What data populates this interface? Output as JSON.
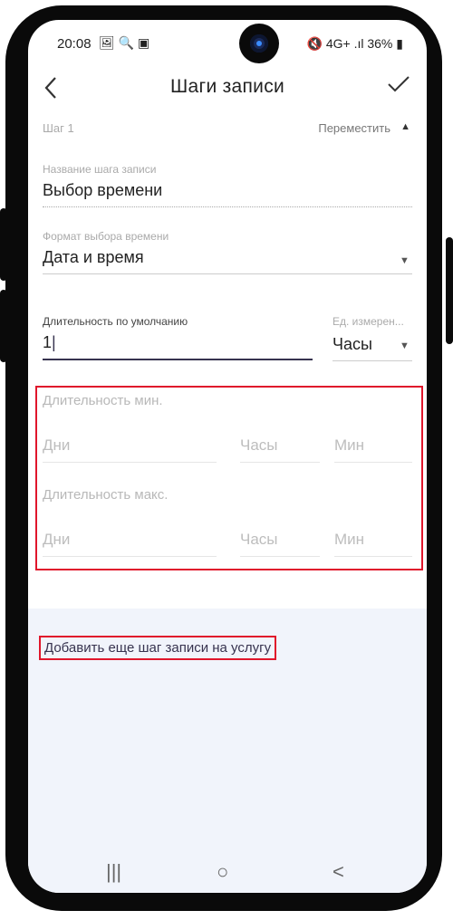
{
  "status_bar": {
    "time": "20:08",
    "left_icons": "🖼 🔍 ▣",
    "right_icons": "🔇 4G+ .ıl",
    "battery": "36%"
  },
  "app_bar": {
    "back_icon": "chevron-left-icon",
    "title": "Шаги записи",
    "confirm_icon": "check-icon"
  },
  "step": {
    "label": "Шаг 1",
    "move_label": "Переместить"
  },
  "step_name": {
    "label": "Название шага записи",
    "value": "Выбор времени"
  },
  "time_format": {
    "label": "Формат выбора времени",
    "value": "Дата и время"
  },
  "default_duration": {
    "label": "Длительность по умолчанию",
    "value": "1",
    "unit_label": "Ед. измерен...",
    "unit_value": "Часы"
  },
  "min_duration": {
    "label": "Длительность мин.",
    "days_placeholder": "Дни",
    "hours_placeholder": "Часы",
    "minutes_placeholder": "Мин"
  },
  "max_duration": {
    "label": "Длительность макс.",
    "days_placeholder": "Дни",
    "hours_placeholder": "Часы",
    "minutes_placeholder": "Мин"
  },
  "add_step_label": "Добавить еще шаг записи на услугу",
  "nav_bar": {
    "recents": "|||",
    "home": "○",
    "back": "<"
  },
  "colors": {
    "highlight": "#e0162b",
    "footer_bg": "#f1f4fb",
    "active_underline": "#37334f"
  }
}
